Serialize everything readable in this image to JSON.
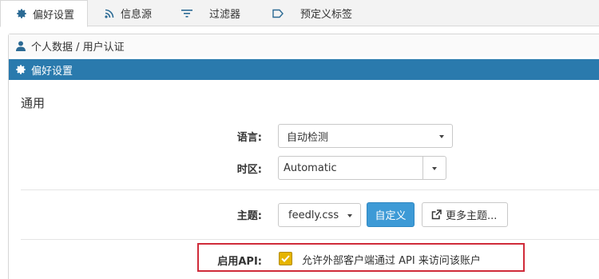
{
  "tabs": [
    {
      "label": "偏好设置",
      "icon": "gear-icon"
    },
    {
      "label": "信息源",
      "icon": "rss-icon"
    },
    {
      "label": "过滤器",
      "icon": "filter-icon"
    },
    {
      "label": "预定义标签",
      "icon": "tag-icon"
    }
  ],
  "breadcrumb": {
    "label": "个人数据 / 用户认证",
    "icon": "user-icon"
  },
  "panel": {
    "title": "偏好设置",
    "icon": "gear-icon"
  },
  "section": {
    "title": "通用"
  },
  "language": {
    "label": "语言:",
    "value": "自动检测"
  },
  "timezone": {
    "label": "时区:",
    "value": "Automatic"
  },
  "theme": {
    "label": "主题:",
    "value": "feedly.css",
    "customize_label": "自定义",
    "more_label": "更多主题..."
  },
  "api": {
    "label": "启用API:",
    "checked": true,
    "text": "允许外部客户端通过 API 来访问该账户"
  },
  "colors": {
    "accent": "#2a7aad",
    "primary_button": "#3d9ad6",
    "checkbox": "#e5b400",
    "highlight": "#d02b3a"
  }
}
